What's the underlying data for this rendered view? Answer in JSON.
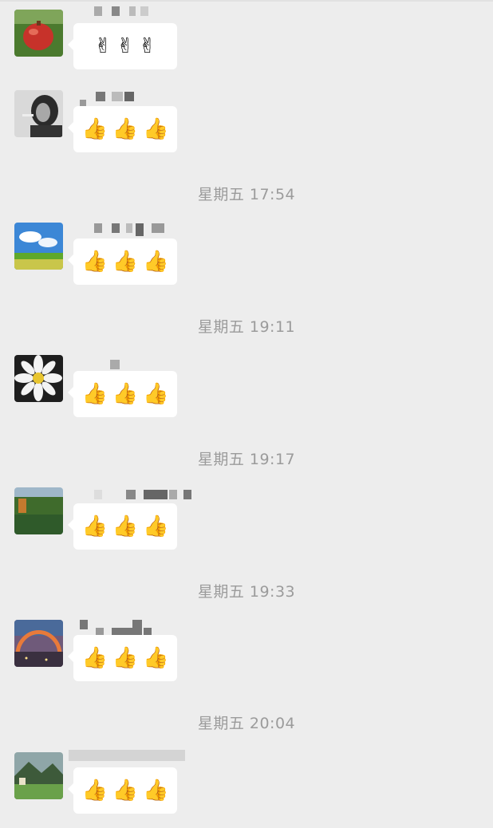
{
  "timestamps": [
    "星期五 17:54",
    "星期五 19:11",
    "星期五 19:17",
    "星期五 19:33",
    "星期五 20:04"
  ],
  "messages": [
    {
      "avatar": "pomegranate-avatar",
      "emojis": [
        "✌",
        "✌",
        "✌"
      ]
    },
    {
      "avatar": "woman-portrait-avatar",
      "emojis": [
        "👍",
        "👍",
        "👍"
      ]
    },
    {
      "avatar": "green-field-sky-avatar",
      "emojis": [
        "👍",
        "👍",
        "👍"
      ]
    },
    {
      "avatar": "daisy-flower-avatar",
      "emojis": [
        "👍",
        "👍",
        "👍"
      ]
    },
    {
      "avatar": "forest-meadow-avatar",
      "emojis": [
        "👍",
        "👍",
        "👍"
      ]
    },
    {
      "avatar": "rainbow-sunset-avatar",
      "emojis": [
        "👍",
        "👍",
        "👍"
      ]
    },
    {
      "avatar": "mountain-village-avatar",
      "emojis": [
        "👍",
        "👍",
        "👍"
      ]
    }
  ],
  "colors": {
    "background": "#ededed",
    "bubble": "#ffffff",
    "timestamp": "#9b9b9b",
    "blur": "#8a8a8a"
  }
}
